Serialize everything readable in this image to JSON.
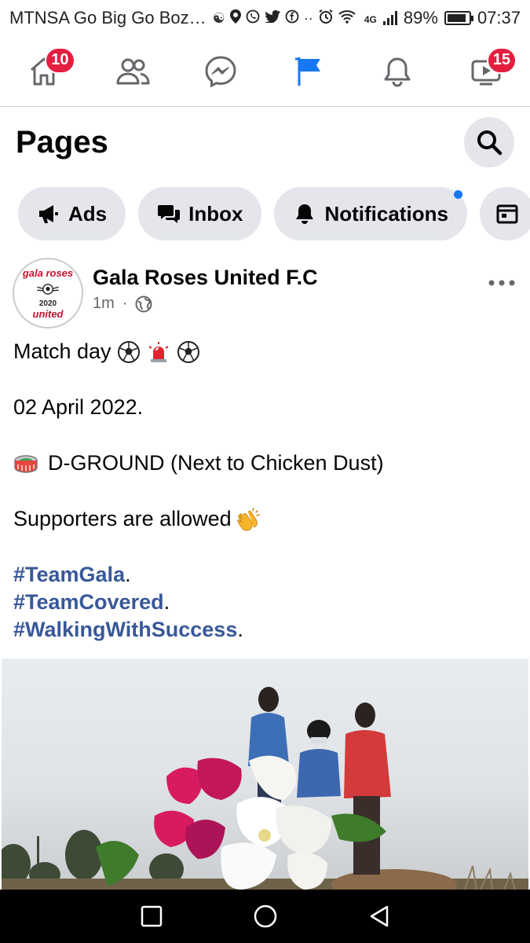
{
  "status_bar": {
    "carrier": "MTNSA Go Big Go Boz…",
    "network": "4G",
    "battery": "89%",
    "battery_level": 0.89,
    "time": "07:37"
  },
  "nav": {
    "home_badge": "10",
    "video_badge": "15",
    "active_tab": "pages",
    "accent_color": "#1877f2",
    "badge_color": "#e41e3f"
  },
  "header": {
    "title": "Pages"
  },
  "chips": [
    {
      "label": "Ads",
      "icon": "megaphone-icon"
    },
    {
      "label": "Inbox",
      "icon": "chat-icon"
    },
    {
      "label": "Notifications",
      "icon": "bell-icon"
    }
  ],
  "post": {
    "author": "Gala Roses United F.C",
    "time": "1m",
    "avatar": {
      "top": "gala roses",
      "year": "2020",
      "bottom": "united"
    },
    "lines": {
      "match": "Match day",
      "date": "02 April 2022.",
      "venue": "D-GROUND (Next to Chicken Dust)",
      "supporters": "Supporters are allowed"
    },
    "hashtags": [
      "#TeamGala",
      "#TeamCovered",
      "#WalkingWithSuccess"
    ],
    "punct": "."
  }
}
